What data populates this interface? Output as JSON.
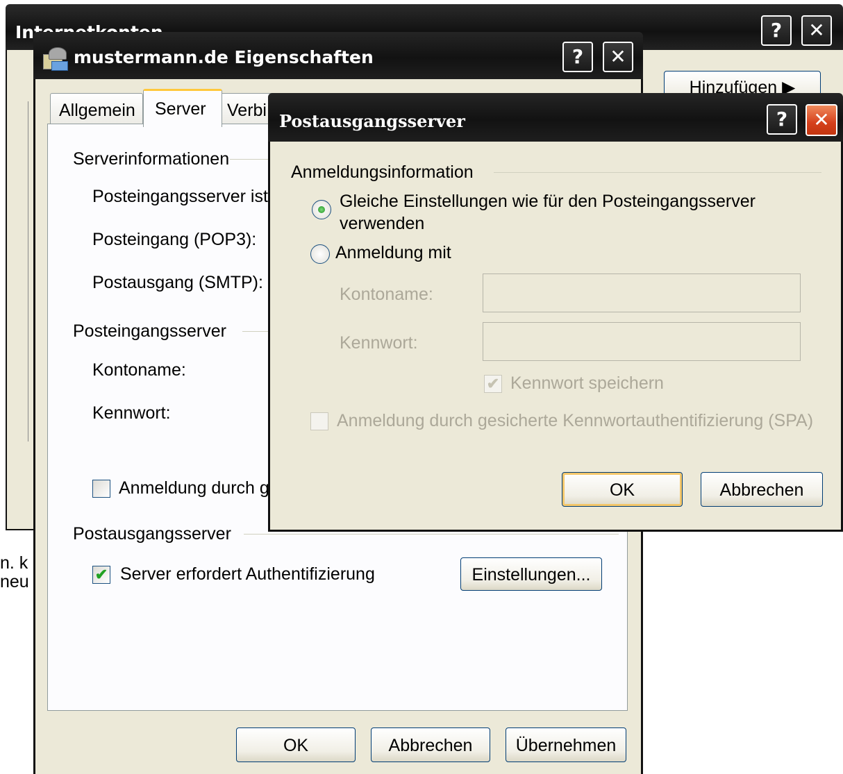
{
  "back_window": {
    "title": "Internetkonten",
    "add_button": "Hinzufügen",
    "side_text_1": "n. k",
    "side_text_2": "neu"
  },
  "props_window": {
    "title": "mustermann.de Eigenschaften",
    "tabs": [
      "Allgemein",
      "Server",
      "Verbi"
    ],
    "section_server_info": "Serverinformationen",
    "incoming_type_label": "Posteingangsserver ist",
    "pop3_label": "Posteingang (POP3):",
    "smtp_label": "Postausgang (SMTP):",
    "section_incoming": "Posteingangsserver",
    "account_label": "Kontoname:",
    "password_label": "Kennwort:",
    "spa_checkbox_label": "Anmeldung durch g",
    "section_outgoing": "Postausgangsserver",
    "auth_checkbox_label": "Server erfordert Authentifizierung",
    "auth_checked": true,
    "settings_button": "Einstellungen...",
    "ok_button": "OK",
    "cancel_button": "Abbrechen",
    "apply_button": "Übernehmen",
    "help_glyph": "?",
    "close_glyph": "✕"
  },
  "smtp_dialog": {
    "title": "Postausgangsserver",
    "section_login": "Anmeldungsinformation",
    "radio_same_line1": "Gleiche Einstellungen wie für den Posteingangsserver",
    "radio_same_line2": "verwenden",
    "radio_same_selected": true,
    "radio_login_with": "Anmeldung mit",
    "account_label": "Kontoname:",
    "account_value": "",
    "password_label": "Kennwort:",
    "password_value": "",
    "save_password_label": "Kennwort speichern",
    "save_password_checked": true,
    "spa_label": "Anmeldung durch gesicherte Kennwortauthentifizierung (SPA)",
    "spa_checked": false,
    "ok_button": "OK",
    "cancel_button": "Abbrechen",
    "help_glyph": "?",
    "close_glyph": "✕",
    "check_glyph": "✔"
  }
}
